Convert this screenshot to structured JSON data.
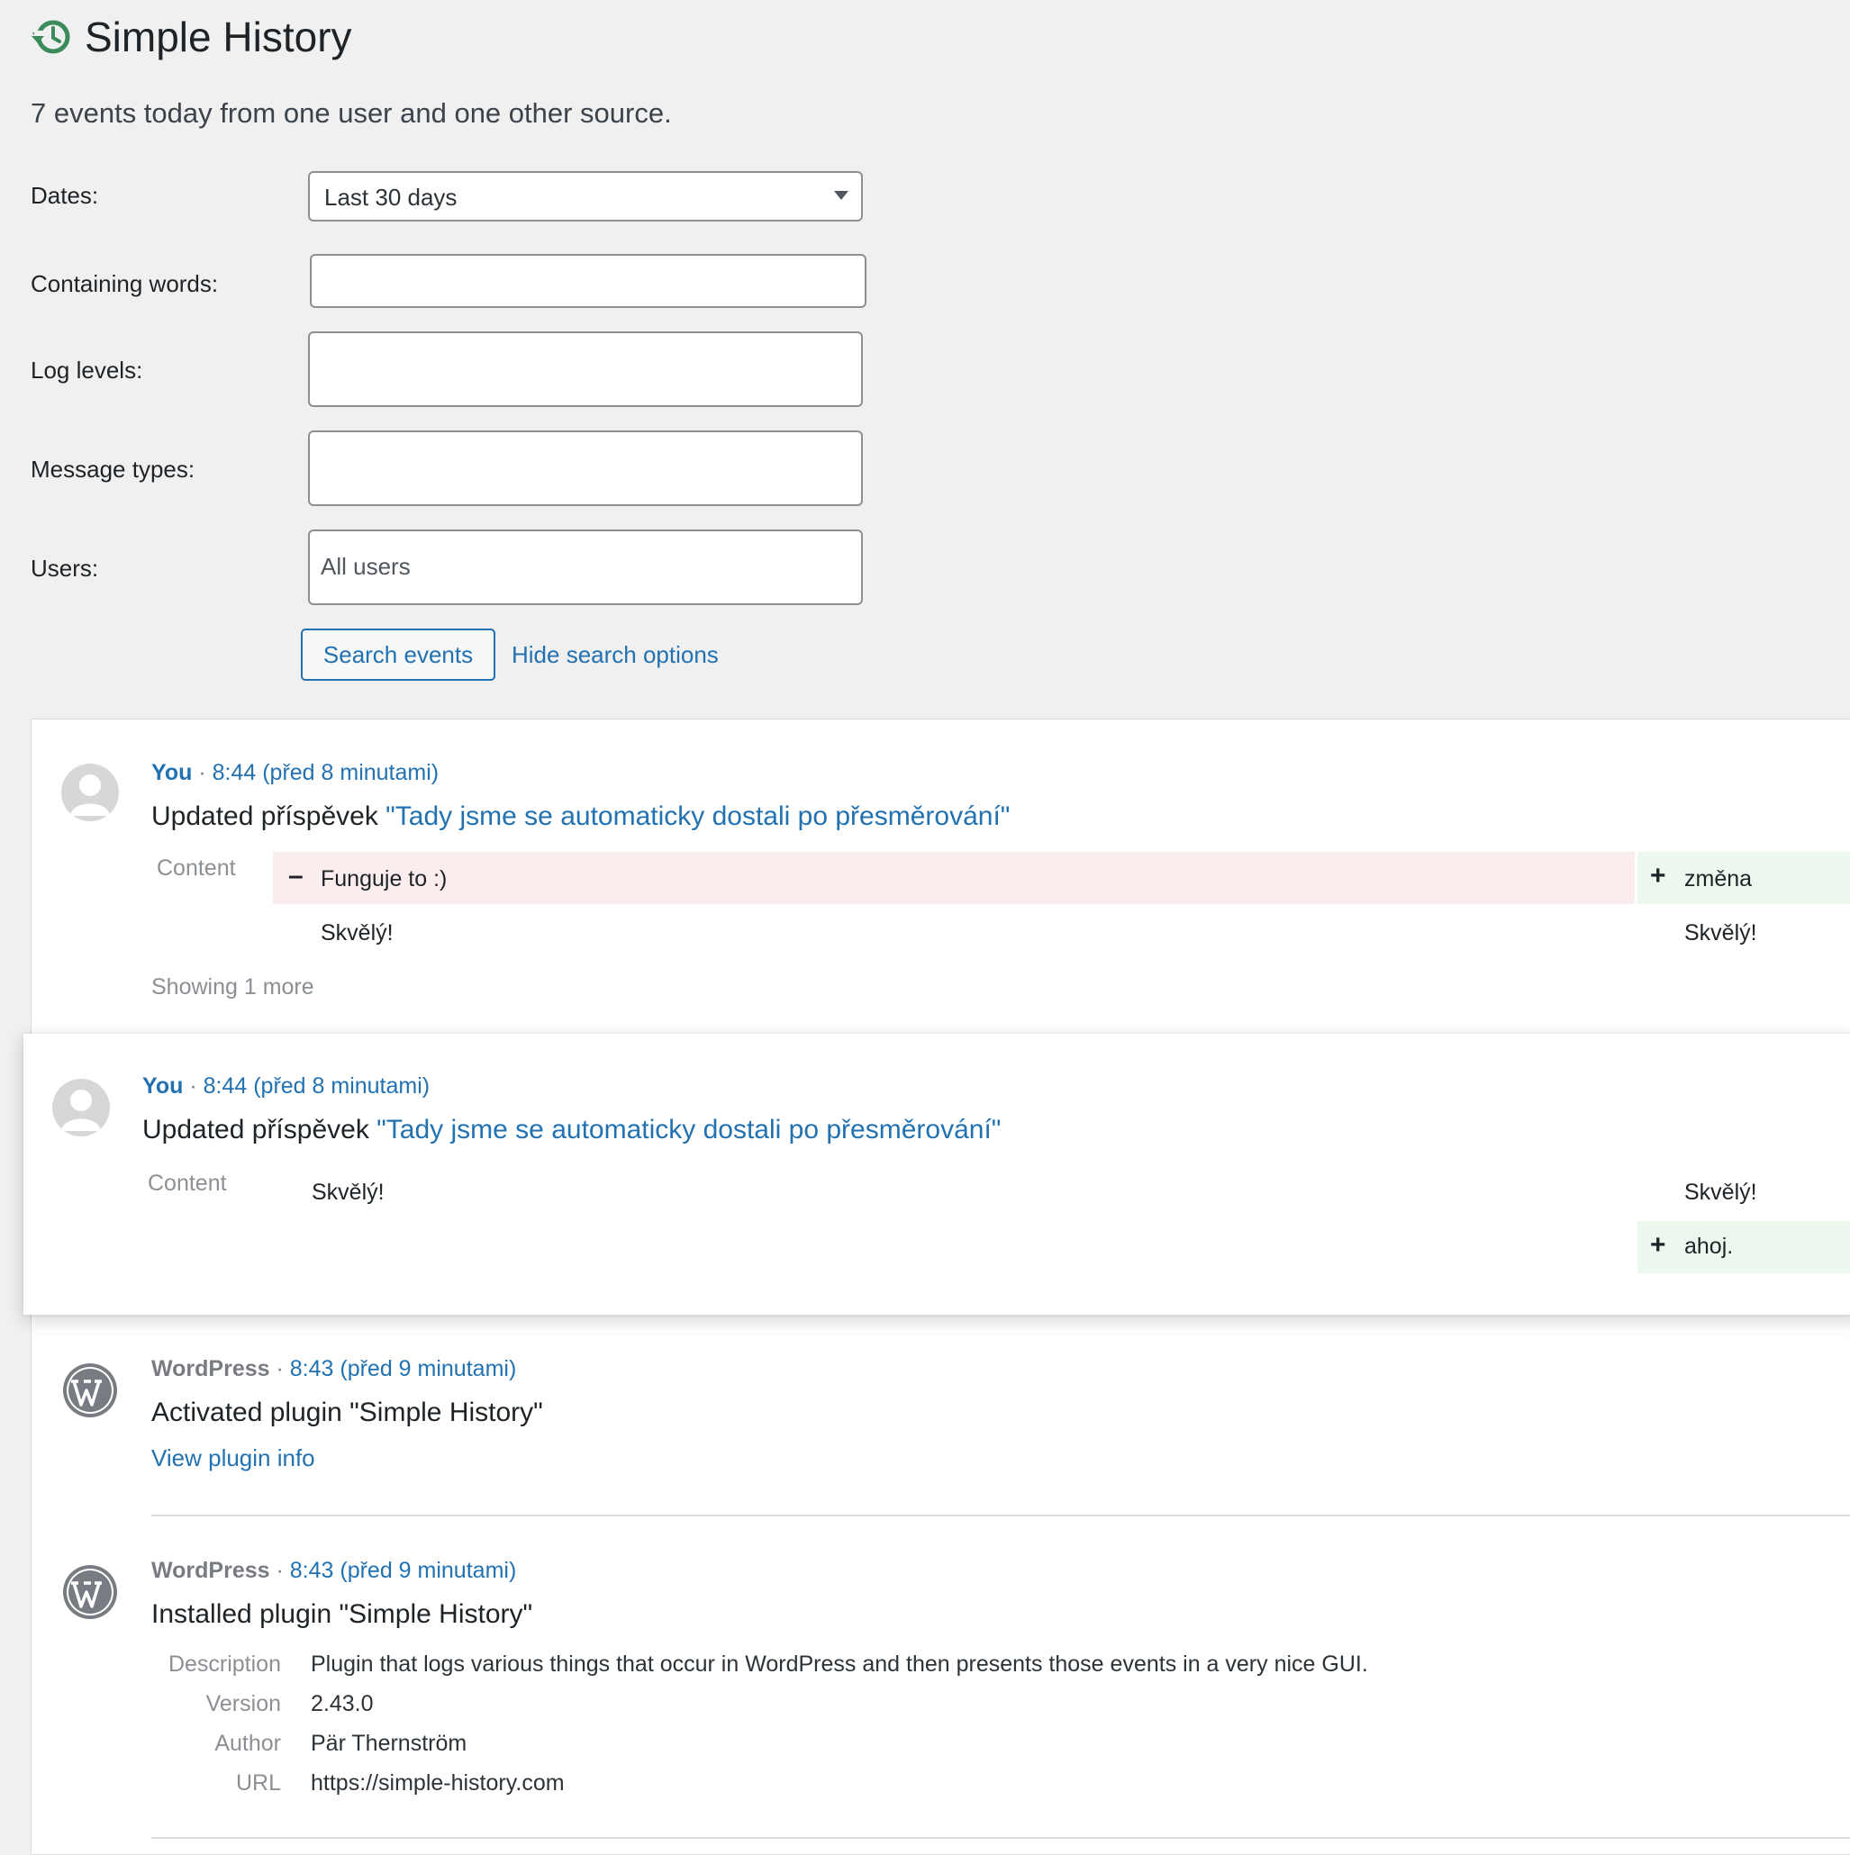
{
  "header": {
    "title": "Simple History",
    "summary": "7 events today from one user and one other source."
  },
  "filters": {
    "dates_label": "Dates:",
    "dates_value": "Last 30 days",
    "words_label": "Containing words:",
    "words_value": "",
    "levels_label": "Log levels:",
    "types_label": "Message types:",
    "users_label": "Users:",
    "users_placeholder": "All users",
    "search_button": "Search events",
    "hide_link": "Hide search options"
  },
  "events": [
    {
      "who": "You",
      "sep": "·",
      "time": "8:44 (před 8 minutami)",
      "action": "Updated příspěvek ",
      "target": "\"Tady jsme se automaticky dostali po přesměrování\"",
      "context_label": "Content",
      "removed": "Funguje to :)",
      "added": "změna",
      "old_unchanged": "Skvělý!",
      "new_unchanged": "Skvělý!",
      "more": "Showing 1 more",
      "minus": "–",
      "plus": "+"
    },
    {
      "who": "You",
      "sep": "·",
      "time": "8:44 (před 8 minutami)",
      "action": "Updated příspěvek ",
      "target": "\"Tady jsme se automaticky dostali po přesměrování\"",
      "context_label": "Content",
      "old_unchanged": "Skvělý!",
      "new_unchanged": "Skvělý!",
      "added": "ahoj.",
      "plus": "+"
    },
    {
      "who": "WordPress",
      "sep": "·",
      "time": "8:43 (před 9 minutami)",
      "message": "Activated plugin \"Simple History\"",
      "link": "View plugin info"
    },
    {
      "who": "WordPress",
      "sep": "·",
      "time": "8:43 (před 9 minutami)",
      "message": "Installed plugin \"Simple History\"",
      "details": [
        {
          "label": "Description",
          "value": "Plugin that logs various things that occur in WordPress and then presents those events in a very nice GUI."
        },
        {
          "label": "Version",
          "value": "2.43.0"
        },
        {
          "label": "Author",
          "value": "Pär Thernström"
        },
        {
          "label": "URL",
          "value": "https://simple-history.com"
        }
      ]
    }
  ],
  "colors": {
    "accent": "#2271b1",
    "removed_bg": "#fbeced",
    "added_bg": "#ecf7ee",
    "logo_green": "#3a8a5b"
  }
}
